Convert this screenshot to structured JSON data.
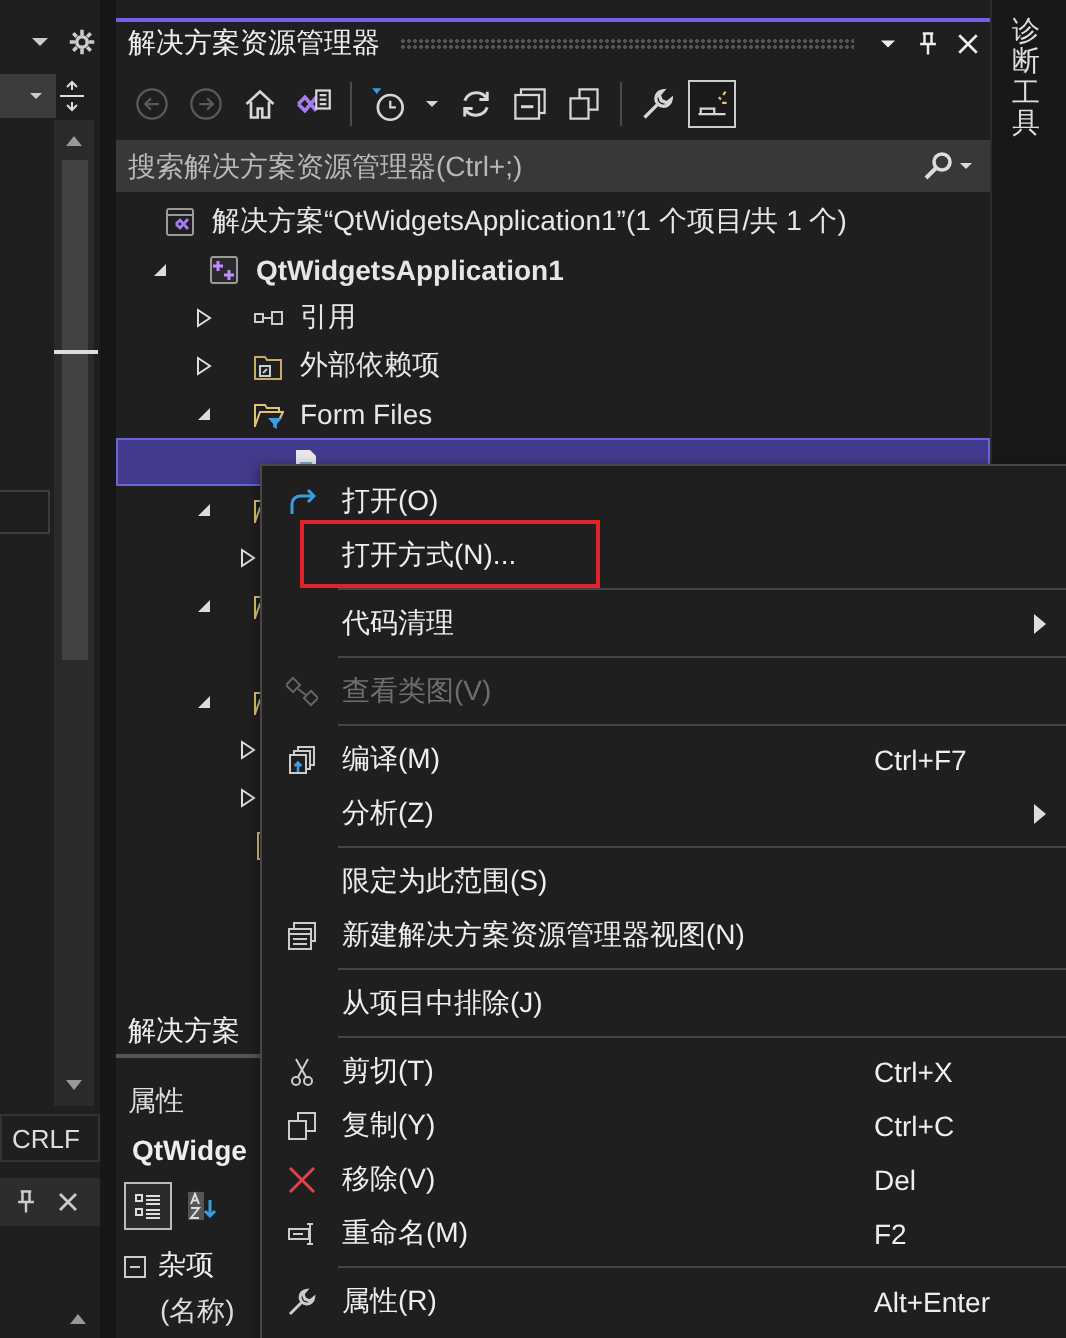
{
  "left_panel": {
    "line_ending": "CRLF"
  },
  "solution_explorer": {
    "title": "解决方案资源管理器",
    "toolbar": [
      {
        "kind": "back",
        "disabled": true,
        "selected": false
      },
      {
        "kind": "forward",
        "disabled": true,
        "selected": false
      },
      {
        "kind": "home",
        "disabled": false,
        "selected": false
      },
      {
        "kind": "switch-views",
        "disabled": false,
        "selected": false
      },
      {
        "kind": "separator"
      },
      {
        "kind": "history",
        "disabled": false,
        "selected": false
      },
      {
        "kind": "caret",
        "disabled": false,
        "selected": false
      },
      {
        "kind": "refresh",
        "disabled": false,
        "selected": false
      },
      {
        "kind": "collapse",
        "disabled": false,
        "selected": false
      },
      {
        "kind": "windows",
        "disabled": false,
        "selected": false
      },
      {
        "kind": "separator"
      },
      {
        "kind": "wrench",
        "disabled": false,
        "selected": false
      },
      {
        "kind": "preview",
        "disabled": false,
        "selected": true
      }
    ],
    "search": {
      "placeholder": "搜索解决方案资源管理器(Ctrl+;)"
    },
    "tree": [
      {
        "kind": "solution",
        "label": "解决方案“QtWidgetsApplication1”(1 个项目/共 1 个)",
        "selected": false,
        "children": [
          {
            "kind": "project",
            "label": "QtWidgetsApplication1",
            "selected": false,
            "expanded": true,
            "children": [
              {
                "kind": "references",
                "label": "引用",
                "selected": false,
                "expanded": false
              },
              {
                "kind": "external",
                "label": "外部依赖项",
                "selected": false,
                "expanded": false
              },
              {
                "kind": "filter-folder",
                "label": "Form Files",
                "selected": false,
                "expanded": true,
                "children": [
                  {
                    "kind": "ui-file",
                    "selected": true
                  }
                ]
              },
              {
                "kind": "filter-folder",
                "selected": false,
                "expanded": true,
                "children": [
                  {
                    "selected": false,
                    "expanded": false
                  }
                ]
              },
              {
                "kind": "filter-folder",
                "selected": false,
                "expanded": true
              },
              {
                "kind": "filter-folder",
                "selected": false,
                "expanded": true,
                "children": [
                  {
                    "selected": false,
                    "expanded": false
                  },
                  {
                    "selected": false,
                    "expanded": false
                  }
                ]
              },
              {
                "kind": "file",
                "selected": false
              }
            ]
          }
        ]
      }
    ]
  },
  "bottom_tab": {
    "label": "解决方案"
  },
  "properties": {
    "title": "属性",
    "object": "QtWidge",
    "toolbar": [
      {
        "kind": "categorized",
        "selected": true
      },
      {
        "kind": "alphabetical",
        "selected": false
      }
    ],
    "categories": [
      {
        "label": "杂项",
        "expanded": true,
        "rows": [
          {
            "name": "(名称)"
          }
        ]
      }
    ]
  },
  "diagnostics_tab": {
    "label": "诊断工具"
  },
  "context_menu": {
    "items": [
      {
        "kind": "open",
        "label": "打开(O)",
        "submenu": false,
        "disabled": false,
        "marked": false
      },
      {
        "kind": "plain",
        "label": "打开方式(N)...",
        "submenu": false,
        "disabled": false,
        "marked": true
      },
      {
        "kind": "separator"
      },
      {
        "kind": "plain",
        "label": "代码清理",
        "submenu": true,
        "disabled": false,
        "marked": false
      },
      {
        "kind": "separator"
      },
      {
        "kind": "class-diagram",
        "label": "查看类图(V)",
        "submenu": false,
        "disabled": true,
        "marked": false
      },
      {
        "kind": "separator"
      },
      {
        "kind": "compile",
        "label": "编译(M)",
        "shortcut": "Ctrl+F7",
        "submenu": false,
        "disabled": false,
        "marked": false
      },
      {
        "kind": "plain",
        "label": "分析(Z)",
        "submenu": true,
        "disabled": false,
        "marked": false
      },
      {
        "kind": "separator"
      },
      {
        "kind": "plain",
        "label": "限定为此范围(S)",
        "submenu": false,
        "disabled": false,
        "marked": false
      },
      {
        "kind": "new-view",
        "label": "新建解决方案资源管理器视图(N)",
        "submenu": false,
        "disabled": false,
        "marked": false
      },
      {
        "kind": "separator"
      },
      {
        "kind": "plain",
        "label": "从项目中排除(J)",
        "submenu": false,
        "disabled": false,
        "marked": false
      },
      {
        "kind": "separator"
      },
      {
        "kind": "cut",
        "label": "剪切(T)",
        "shortcut": "Ctrl+X",
        "submenu": false,
        "disabled": false,
        "marked": false
      },
      {
        "kind": "copy",
        "label": "复制(Y)",
        "shortcut": "Ctrl+C",
        "submenu": false,
        "disabled": false,
        "marked": false
      },
      {
        "kind": "remove",
        "label": "移除(V)",
        "shortcut": "Del",
        "submenu": false,
        "disabled": false,
        "marked": false
      },
      {
        "kind": "rename",
        "label": "重命名(M)",
        "shortcut": "F2",
        "submenu": false,
        "disabled": false,
        "marked": false
      },
      {
        "kind": "separator"
      },
      {
        "kind": "properties",
        "label": "属性(R)",
        "shortcut": "Alt+Enter",
        "submenu": false,
        "disabled": false,
        "marked": false
      }
    ]
  }
}
